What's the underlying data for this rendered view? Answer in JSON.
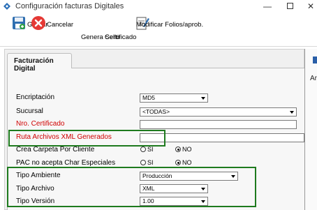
{
  "window": {
    "title": "Configuración facturas Digitales",
    "minimize": "—",
    "close": "✕"
  },
  "toolbar": {
    "grabar": "Grabar",
    "cancelar": "Cancelar",
    "genera_sello": "Genera Sello",
    "certificado": "Certificado",
    "modificar_folios": "Modificar Folios/aprob."
  },
  "tab": {
    "label": "Facturación Digital"
  },
  "right_panel": {
    "label": "Arc"
  },
  "form": {
    "encriptacion": {
      "label": "Encriptación",
      "value": "MD5"
    },
    "sucursal": {
      "label": "Sucursal",
      "value": "<TODAS>"
    },
    "nro_certificado": {
      "label": "Nro. Certificado",
      "value": ""
    },
    "ruta_archivos": {
      "label": "Ruta Archivos XML Generados",
      "value": ""
    },
    "crea_carpeta": {
      "label": "Crea Carpeta Por Cliente",
      "opt_si": "SI",
      "opt_no": "NO",
      "selected": "NO"
    },
    "pac_char": {
      "label": "PAC no acepta Char Especiales",
      "opt_si": "SI",
      "opt_no": "NO",
      "selected": "NO"
    },
    "tipo_ambiente": {
      "label": "Tipo Ambiente",
      "value": "Producción"
    },
    "tipo_archivo": {
      "label": "Tipo Archivo",
      "value": "XML"
    },
    "tipo_version": {
      "label": "Tipo Versión",
      "value": "1.00"
    }
  },
  "colors": {
    "highlight": "#1e7a1e",
    "required_label": "#d00000",
    "accent": "#2a5fa8"
  }
}
